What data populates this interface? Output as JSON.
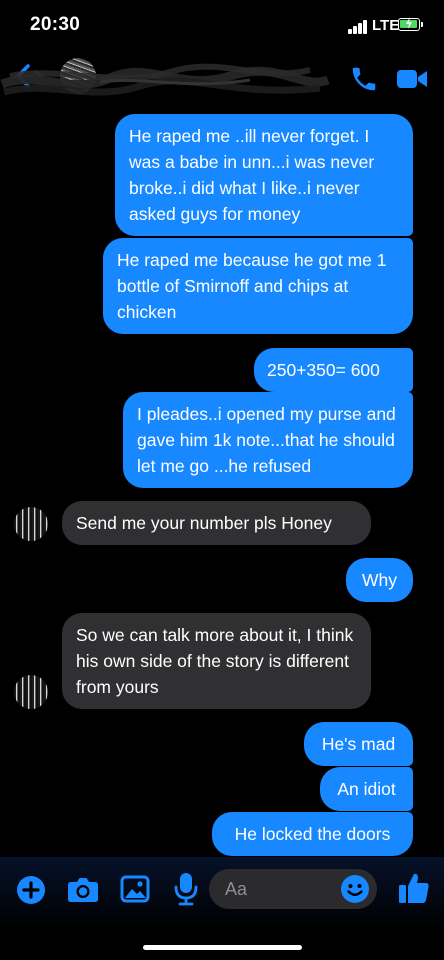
{
  "status_bar": {
    "time": "20:30",
    "network": "LTE"
  },
  "header": {
    "back_icon": "back-chevron-icon",
    "call_icon": "phone-icon",
    "video_icon": "video-camera-icon",
    "accent": "#1788ff"
  },
  "messages": [
    {
      "from": "me",
      "text": "He raped me ..ill never forget. I was a babe in unn...i was never broke..i did what I like..i never asked guys for money"
    },
    {
      "from": "me",
      "text": "He raped me because he got me 1 bottle of Smirnoff and chips at chicken"
    },
    {
      "from": "me",
      "text": "250+350= 600"
    },
    {
      "from": "me",
      "text": "I pleades..i opened my purse and gave him 1k note...that he should let me go ...he refused"
    },
    {
      "from": "them",
      "text": "Send me your number pls Honey"
    },
    {
      "from": "me",
      "text": "Why"
    },
    {
      "from": "them",
      "text": "So we can talk more about it, I think his own side of the story is different from yours"
    },
    {
      "from": "me",
      "text": "He's mad"
    },
    {
      "from": "me",
      "text": "An idiot"
    },
    {
      "from": "me",
      "text": "He locked the doors"
    }
  ],
  "composer": {
    "placeholder": "Aa",
    "icons": [
      "plus-icon",
      "camera-icon",
      "image-icon",
      "microphone-icon",
      "emoji-icon",
      "thumbs-up-icon"
    ]
  },
  "colors": {
    "sent_bubble": "#1788ff",
    "received_bubble": "#303032",
    "background": "#000000"
  }
}
